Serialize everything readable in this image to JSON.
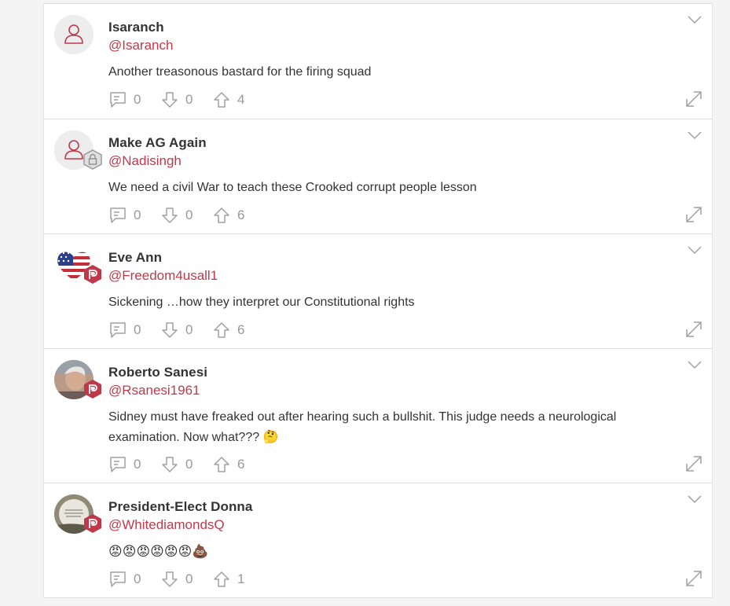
{
  "posts": [
    {
      "name": "Isaranch",
      "handle": "@Isaranch",
      "text": "Another treasonous bastard for the firing squad",
      "avatar": "default-user-icon",
      "badge": "none",
      "comments": "0",
      "downvotes": "0",
      "upvotes": "4"
    },
    {
      "name": "Make AG Again",
      "handle": "@Nadisingh",
      "text": "We need a civil War to teach these Crooked corrupt people lesson",
      "avatar": "default-user-icon",
      "badge": "lock-badge",
      "comments": "0",
      "downvotes": "0",
      "upvotes": "6"
    },
    {
      "name": "Eve Ann",
      "handle": "@Freedom4usall1",
      "text": "Sickening …how they interpret our Constitutional rights",
      "avatar": "us-flag-heart",
      "badge": "parler-badge",
      "comments": "0",
      "downvotes": "0",
      "upvotes": "6"
    },
    {
      "name": "Roberto Sanesi",
      "handle": "@Rsanesi1961",
      "text": "Sidney must have freaked out after hearing such a bullshit. This judge needs a neurological examination. Now what??? 🤔",
      "avatar": "photo",
      "badge": "parler-badge",
      "comments": "0",
      "downvotes": "0",
      "upvotes": "6"
    },
    {
      "name": "President-Elect Donna",
      "handle": "@WhitediamondsQ",
      "text": "😡😡😡😡😡😡💩",
      "avatar": "photo",
      "badge": "parler-badge",
      "comments": "0",
      "downvotes": "0",
      "upvotes": "1"
    }
  ],
  "colors": {
    "accent": "#c0394b",
    "icon": "#a0a0a0",
    "text": "#333333",
    "muted": "#999999"
  }
}
